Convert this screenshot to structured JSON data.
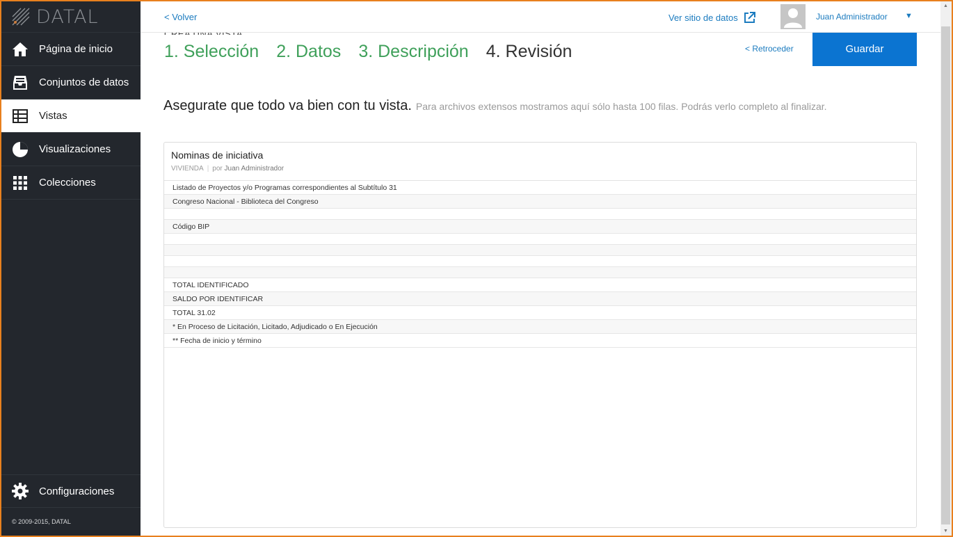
{
  "app": {
    "logo_text": "DATAL"
  },
  "sidebar": {
    "items": [
      {
        "label": "Página de inicio",
        "icon": "home-icon"
      },
      {
        "label": "Conjuntos de datos",
        "icon": "inbox-icon"
      },
      {
        "label": "Vistas",
        "icon": "table-icon",
        "active": true
      },
      {
        "label": "Visualizaciones",
        "icon": "pie-chart-icon"
      },
      {
        "label": "Colecciones",
        "icon": "grid-icon"
      }
    ],
    "settings_label": "Configuraciones",
    "copyright": "© 2009-2015, DATAL"
  },
  "topbar": {
    "back_label": "< Volver",
    "site_link_label": "Ver sitio de datos",
    "user_name": "Juan Administrador",
    "user_caret": "▼"
  },
  "wizard": {
    "header": "CREA UNA VISTA",
    "steps": [
      "1. Selección",
      "2. Datos",
      "3. Descripción",
      "4. Revisión"
    ],
    "current_step": 4,
    "back_label": "< Retroceder",
    "save_label": "Guardar"
  },
  "review": {
    "title": "Asegurate que todo va bien con tu vista.",
    "subtitle": "Para archivos extensos mostramos aquí sólo hasta 100 filas. Podrás verlo completo al finalizar."
  },
  "card": {
    "title": "Nominas de iniciativa",
    "category": "VIVIENDA",
    "author_prefix": "por",
    "author": "Juan Administrador",
    "rows": [
      "Listado de Proyectos y/o Programas correspondientes al Subtítulo 31",
      "Congreso Nacional - Biblioteca del Congreso",
      "",
      "Código BIP",
      "",
      "",
      "",
      "",
      "TOTAL IDENTIFICADO",
      "SALDO POR IDENTIFICAR",
      "TOTAL 31.02",
      "* En Proceso de Licitación, Licitado, Adjudicado o En Ejecución",
      "** Fecha de inicio y término"
    ]
  },
  "colors": {
    "sidebar_bg": "#23272d",
    "accent_blue": "#0b74d1",
    "link_blue": "#1b7bbf",
    "step_green": "#3fa05a",
    "frame_orange": "#e8801e"
  }
}
